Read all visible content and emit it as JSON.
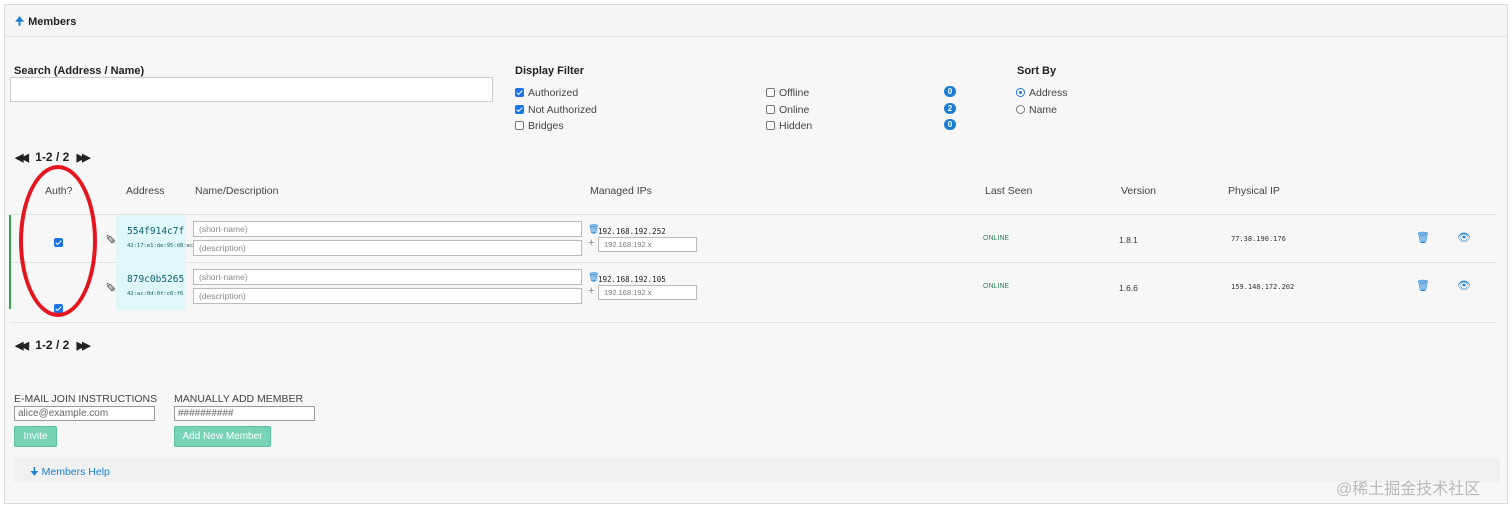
{
  "panel": {
    "title": "Members"
  },
  "search": {
    "label": "Search (Address / Name)",
    "value": ""
  },
  "display_filter": {
    "label": "Display Filter",
    "left": [
      {
        "label": "Authorized",
        "checked": true
      },
      {
        "label": "Not Authorized",
        "checked": true
      },
      {
        "label": "Bridges",
        "checked": false
      }
    ],
    "right": [
      {
        "label": "Offline",
        "checked": false,
        "count": "0"
      },
      {
        "label": "Online",
        "checked": false,
        "count": "2"
      },
      {
        "label": "Hidden",
        "checked": false,
        "count": "0"
      }
    ]
  },
  "sort_by": {
    "label": "Sort By",
    "options": [
      {
        "label": "Address",
        "selected": true
      },
      {
        "label": "Name",
        "selected": false
      }
    ]
  },
  "pager": {
    "range": "1-2",
    "separator": "/",
    "total": "2"
  },
  "table": {
    "headers": {
      "auth": "Auth?",
      "address": "Address",
      "name": "Name/Description",
      "managed_ips": "Managed IPs",
      "last_seen": "Last Seen",
      "version": "Version",
      "physical_ip": "Physical IP"
    },
    "rows": [
      {
        "authorized": true,
        "address": "554f914c7f",
        "mac": "42:17:e1:de:95:d8:ec",
        "short_name_placeholder": "(short-name)",
        "description_placeholder": "(description)",
        "managed_ip": "192.168.192.252",
        "ip_placeholder": "192.168.192.x",
        "last_seen": "ONLINE",
        "version": "1.8.1",
        "physical_ip": "77.38.190.176"
      },
      {
        "authorized": true,
        "address": "879c0b5265",
        "mac": "42:ac:0d:0f:c6:f6",
        "short_name_placeholder": "(short-name)",
        "description_placeholder": "(description)",
        "managed_ip": "192.168.192.105",
        "ip_placeholder": "192.168.192.x",
        "last_seen": "ONLINE",
        "version": "1.6.6",
        "physical_ip": "159.148.172.202"
      }
    ]
  },
  "invite": {
    "label": "E-MAIL JOIN INSTRUCTIONS",
    "placeholder": "alice@example.com",
    "button": "Invite"
  },
  "add_member": {
    "label": "MANUALLY ADD MEMBER",
    "placeholder": "##########",
    "button": "Add New Member"
  },
  "help": {
    "label": "Members Help"
  },
  "watermark": "@稀土掘金技术社区",
  "colors": {
    "accent": "#1a7fd4",
    "online": "#2e7d57",
    "button": "#77d2b6",
    "annotation": "#e4151f",
    "address_bg": "#e0f7fa"
  },
  "icons": {
    "collapse": "arrow-up-icon",
    "trash": "trash-icon",
    "hide": "eye-slash-icon",
    "edit": "pencil-icon",
    "add_ip": "plus-icon",
    "help": "arrow-down-icon"
  }
}
